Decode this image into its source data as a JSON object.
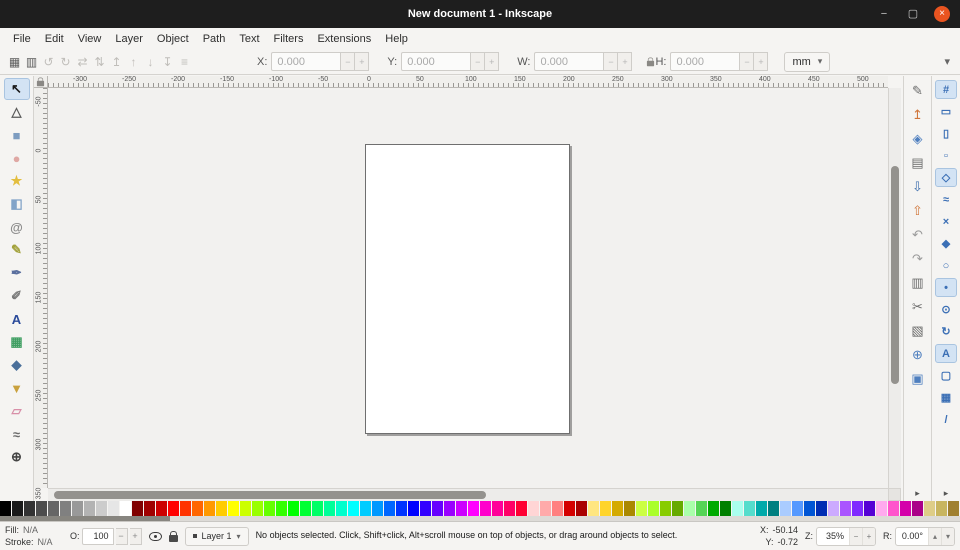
{
  "titlebar": {
    "title": "New document 1 - Inkscape",
    "minimize_glyph": "−",
    "restore_glyph": "▢",
    "close_glyph": "×"
  },
  "menubar": {
    "items": [
      "File",
      "Edit",
      "View",
      "Layer",
      "Object",
      "Path",
      "Text",
      "Filters",
      "Extensions",
      "Help"
    ]
  },
  "toolbar": {
    "left_icons": [
      {
        "name": "selection-dialog-icon",
        "glyph": "▦",
        "color": "#5a5a5a"
      },
      {
        "name": "select-all-icon",
        "glyph": "▥",
        "color": "#5a5a5a"
      },
      {
        "name": "rotate-ccw-icon",
        "glyph": "↺",
        "color": "#c0beba"
      },
      {
        "name": "rotate-cw-icon",
        "glyph": "↻",
        "color": "#c0beba"
      },
      {
        "name": "flip-horizontal-icon",
        "glyph": "⇄",
        "color": "#c0beba"
      },
      {
        "name": "flip-vertical-icon",
        "glyph": "⇅",
        "color": "#c0beba"
      },
      {
        "name": "raise-to-top-icon",
        "glyph": "↥",
        "color": "#c0beba"
      },
      {
        "name": "raise-icon",
        "glyph": "↑",
        "color": "#c0beba"
      },
      {
        "name": "lower-icon",
        "glyph": "↓",
        "color": "#c0beba"
      },
      {
        "name": "lower-to-bottom-icon",
        "glyph": "↧",
        "color": "#c0beba"
      },
      {
        "name": "transform-dialog-icon",
        "glyph": "≡",
        "color": "#c0beba"
      }
    ],
    "fields": [
      {
        "label": "X:",
        "value": "0.000"
      },
      {
        "label": "Y:",
        "value": "0.000"
      },
      {
        "label": "W:",
        "value": "0.000"
      },
      {
        "label": "H:",
        "value": "0.000"
      }
    ],
    "minus": "−",
    "plus": "+",
    "unit": "mm",
    "unit_arrow": "▾",
    "overflow_arrow": "▾"
  },
  "rulers": {
    "h_labels": [
      "-300",
      "-250",
      "-200",
      "-150",
      "-100",
      "-50",
      "0",
      "50",
      "100",
      "150",
      "200",
      "250",
      "300",
      "350",
      "400",
      "450",
      "500"
    ],
    "v_labels": [
      "-50",
      "0",
      "50",
      "100",
      "150",
      "200",
      "250",
      "300",
      "350"
    ]
  },
  "toolbox": {
    "tools": [
      {
        "name": "selector-tool",
        "glyph": "↖",
        "color": "#1a1a1a",
        "state": "pressed"
      },
      {
        "name": "node-tool",
        "glyph": "△",
        "color": "#5a5a5a"
      },
      {
        "name": "rectangle-tool",
        "glyph": "■",
        "color": "#7d9cc0"
      },
      {
        "name": "ellipse-tool",
        "glyph": "●",
        "color": "#dfa8a4"
      },
      {
        "name": "star-tool",
        "glyph": "★",
        "color": "#e3be3f"
      },
      {
        "name": "box3d-tool",
        "glyph": "◧",
        "color": "#81a3c8"
      },
      {
        "name": "spiral-tool",
        "glyph": "@",
        "color": "#8a8a8a"
      },
      {
        "name": "pencil-tool",
        "glyph": "✎",
        "color": "#a3a23d"
      },
      {
        "name": "pen-tool",
        "glyph": "✒",
        "color": "#5a6f9e"
      },
      {
        "name": "calligraphy-tool",
        "glyph": "✐",
        "color": "#7a7a7a"
      },
      {
        "name": "text-tool",
        "glyph": "A",
        "color": "#2a4a9a"
      },
      {
        "name": "gradient-tool",
        "glyph": "▦",
        "color": "#3f9e62"
      },
      {
        "name": "dropper-tool",
        "glyph": "◆",
        "color": "#4a6f9a"
      },
      {
        "name": "bucket-tool",
        "glyph": "▼",
        "color": "#c9a13e"
      },
      {
        "name": "eraser-tool",
        "glyph": "▱",
        "color": "#d88fa8"
      },
      {
        "name": "connector-tool",
        "glyph": "≈",
        "color": "#6a6a6a"
      },
      {
        "name": "zoom-tool",
        "glyph": "⊕",
        "color": "#444444"
      }
    ]
  },
  "commands": {
    "items": [
      {
        "name": "edit-icon",
        "glyph": "✎",
        "color": "#6b6b6b"
      },
      {
        "name": "export-png-icon",
        "glyph": "↥",
        "color": "#d0763b"
      },
      {
        "name": "filters-icon",
        "glyph": "◈",
        "color": "#4f7fbf"
      },
      {
        "name": "print-icon",
        "glyph": "▤",
        "color": "#6b6b6b"
      },
      {
        "name": "import-icon",
        "glyph": "⇩",
        "color": "#3f6fae"
      },
      {
        "name": "export-icon",
        "glyph": "⇧",
        "color": "#d0763b"
      },
      {
        "name": "undo-icon",
        "glyph": "↶",
        "color": "#9a9a9a"
      },
      {
        "name": "redo-icon",
        "glyph": "↷",
        "color": "#9a9a9a"
      },
      {
        "name": "copy-icon",
        "glyph": "▥",
        "color": "#6b6b6b"
      },
      {
        "name": "cut-icon",
        "glyph": "✂",
        "color": "#6b6b6b"
      },
      {
        "name": "paste-icon",
        "glyph": "▧",
        "color": "#6b6b6b"
      },
      {
        "name": "zoom-drawing-icon",
        "glyph": "⊕",
        "color": "#4f7fbf"
      },
      {
        "name": "zoom-page-icon",
        "glyph": "▣",
        "color": "#4f7fbf"
      }
    ],
    "more": "▸"
  },
  "snapbar": {
    "items": [
      {
        "name": "snap-enable-icon",
        "glyph": "#",
        "color": "#3b6fb5",
        "state": "pressed"
      },
      {
        "name": "snap-bbox-icon",
        "glyph": "▭",
        "color": "#3b6fb5"
      },
      {
        "name": "snap-bbox-edges-icon",
        "glyph": "▯",
        "color": "#3b6fb5"
      },
      {
        "name": "snap-bbox-corners-icon",
        "glyph": "▫",
        "color": "#3b6fb5"
      },
      {
        "name": "snap-nodes-icon",
        "glyph": "◇",
        "color": "#3b6fb5",
        "state": "pressed"
      },
      {
        "name": "snap-path-icon",
        "glyph": "≈",
        "color": "#3b6fb5"
      },
      {
        "name": "snap-intersections-icon",
        "glyph": "×",
        "color": "#3b6fb5"
      },
      {
        "name": "snap-cusp-icon",
        "glyph": "◆",
        "color": "#3b6fb5"
      },
      {
        "name": "snap-smooth-icon",
        "glyph": "○",
        "color": "#3b6fb5"
      },
      {
        "name": "snap-midpoint-icon",
        "glyph": "•",
        "color": "#3b6fb5",
        "state": "pressed"
      },
      {
        "name": "snap-center-icon",
        "glyph": "⊙",
        "color": "#3b6fb5"
      },
      {
        "name": "snap-rotation-icon",
        "glyph": "↻",
        "color": "#3b6fb5"
      },
      {
        "name": "snap-text-icon",
        "glyph": "A",
        "color": "#3b6fb5",
        "state": "pressed"
      },
      {
        "name": "snap-page-icon",
        "glyph": "▢",
        "color": "#3b6fb5"
      },
      {
        "name": "snap-grid-icon",
        "glyph": "▦",
        "color": "#3b6fb5"
      },
      {
        "name": "snap-guide-icon",
        "glyph": "/",
        "color": "#3b6fb5"
      }
    ],
    "more": "▸"
  },
  "palette": {
    "colors": [
      "#000000",
      "#1a1a1a",
      "#333333",
      "#4d4d4d",
      "#666666",
      "#808080",
      "#999999",
      "#b3b3b3",
      "#cccccc",
      "#e6e6e6",
      "#ffffff",
      "#800000",
      "#a00000",
      "#cc0000",
      "#ff0000",
      "#ff3300",
      "#ff6600",
      "#ff9900",
      "#ffcc00",
      "#ffff00",
      "#ccff00",
      "#99ff00",
      "#66ff00",
      "#33ff00",
      "#00ff00",
      "#00ff33",
      "#00ff66",
      "#00ff99",
      "#00ffcc",
      "#00ffff",
      "#00ccff",
      "#0099ff",
      "#0066ff",
      "#0033ff",
      "#0000ff",
      "#3300ff",
      "#6600ff",
      "#9900ff",
      "#cc00ff",
      "#ff00ff",
      "#ff00cc",
      "#ff0099",
      "#ff0066",
      "#ff0033",
      "#ffd5d5",
      "#ffaaaa",
      "#ff8080",
      "#d40000",
      "#aa0000",
      "#ffe680",
      "#ffd42a",
      "#d4aa00",
      "#aa8800",
      "#ccff42",
      "#aaff2a",
      "#88cc00",
      "#66aa00",
      "#aaffaa",
      "#55d455",
      "#00aa00",
      "#008000",
      "#aaffee",
      "#55ddcc",
      "#00aaaa",
      "#008080",
      "#aaccff",
      "#5599ff",
      "#0055d4",
      "#002db3",
      "#ccaaff",
      "#aa55ff",
      "#7f2aff",
      "#5500d4",
      "#ffaaee",
      "#ff55cc",
      "#d400aa",
      "#aa0088",
      "#decd87",
      "#c8b55f",
      "#a08030"
    ]
  },
  "statusbar": {
    "fill_label": "Fill:",
    "fill_value": "N/A",
    "stroke_label": "Stroke:",
    "stroke_value": "N/A",
    "opacity_label": "O:",
    "opacity_value": "100",
    "minus": "−",
    "plus": "+",
    "layer": "Layer 1",
    "layer_arrow": "▾",
    "message": "No objects selected. Click, Shift+click, Alt+scroll mouse on top of objects, or drag around objects to select.",
    "x_label": "X:",
    "x_value": "-50.14",
    "y_label": "Y:",
    "y_value": "-0.72",
    "zoom_label": "Z:",
    "zoom_value": "35%",
    "rotation_label": "R:",
    "rotation_value": "0.00°",
    "up_arrow": "▴",
    "down_arrow": "▾"
  }
}
